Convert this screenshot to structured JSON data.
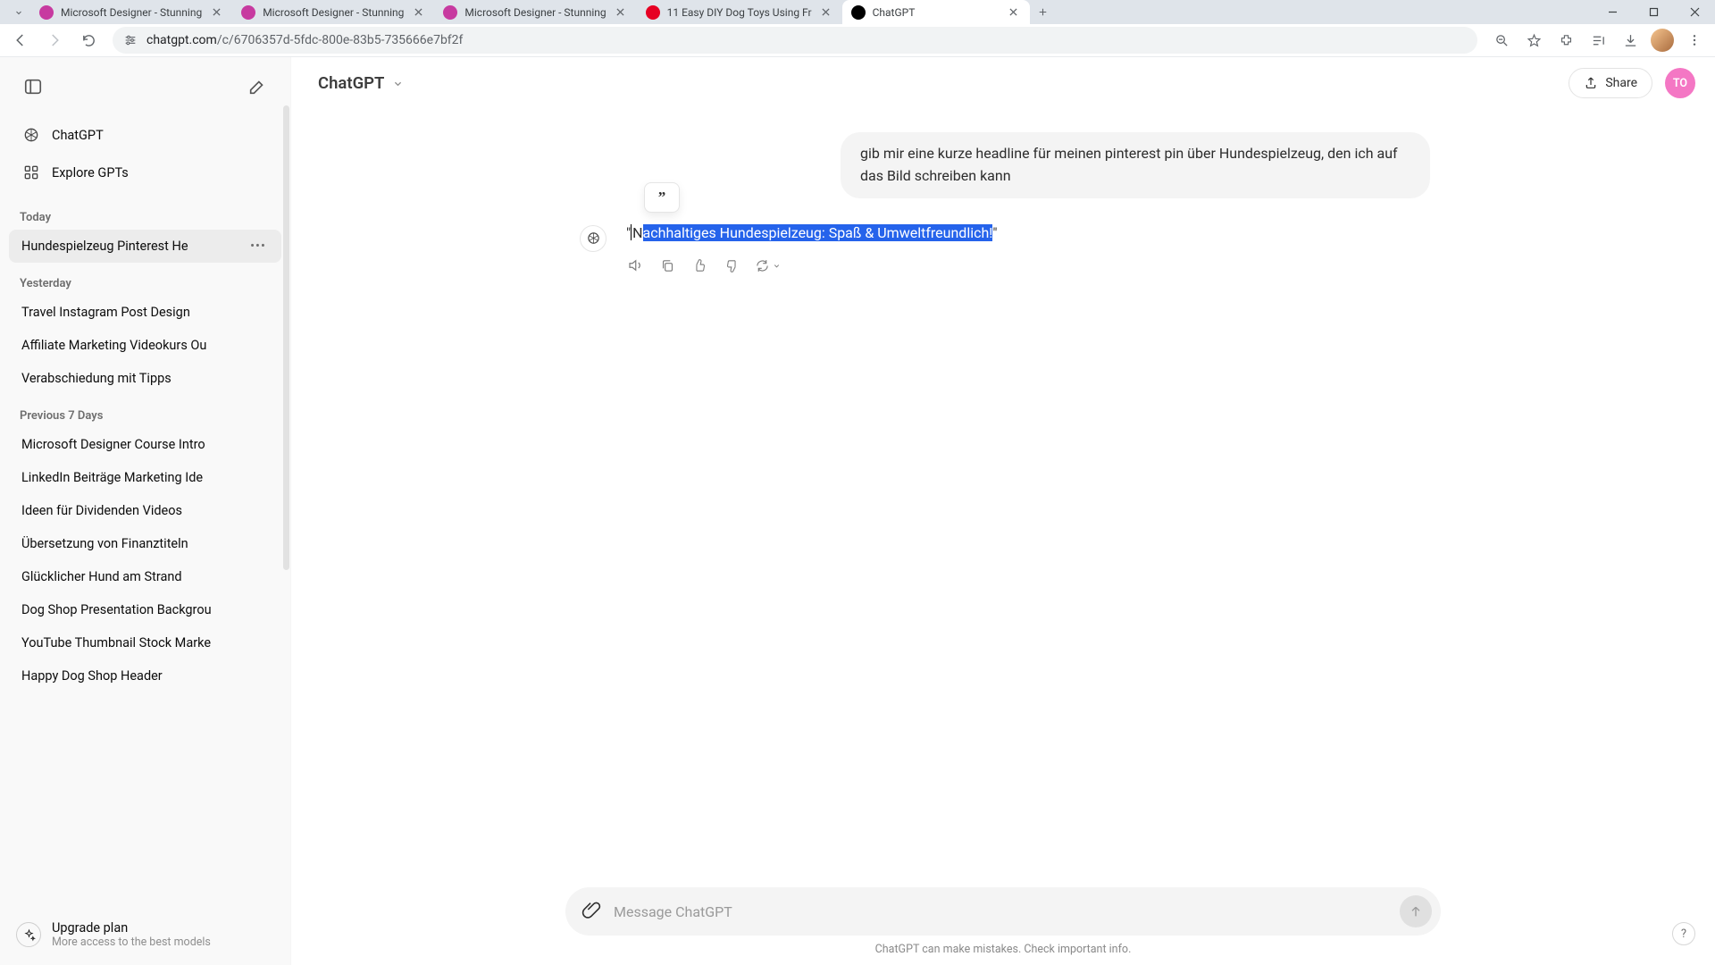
{
  "browser": {
    "tabs": [
      {
        "title": "Microsoft Designer - Stunning",
        "favicon": "#c73aa0"
      },
      {
        "title": "Microsoft Designer - Stunning",
        "favicon": "#c73aa0"
      },
      {
        "title": "Microsoft Designer - Stunning",
        "favicon": "#c73aa0"
      },
      {
        "title": "11 Easy DIY Dog Toys Using Fr",
        "favicon": "#e60023"
      },
      {
        "title": "ChatGPT",
        "favicon": "#000000",
        "active": true
      }
    ],
    "url_host": "chatgpt.com",
    "url_path": "/c/6706357d-5fdc-800e-83b5-735666e7bf2f"
  },
  "sidebar": {
    "nav_chatgpt": "ChatGPT",
    "nav_explore": "Explore GPTs",
    "sections": [
      {
        "header": "Today",
        "items": [
          "Hundespielzeug Pinterest He"
        ],
        "active_index": 0
      },
      {
        "header": "Yesterday",
        "items": [
          "Travel Instagram Post Design",
          "Affiliate Marketing Videokurs Ou",
          "Verabschiedung mit Tipps"
        ]
      },
      {
        "header": "Previous 7 Days",
        "items": [
          "Microsoft Designer Course Intro",
          "LinkedIn Beiträge Marketing Ide",
          "Ideen für Dividenden Videos",
          "Übersetzung von Finanztiteln",
          "Glücklicher Hund am Strand",
          "Dog Shop Presentation Backgrou",
          "YouTube Thumbnail Stock Marke",
          "Happy Dog Shop Header"
        ]
      }
    ],
    "plan_title": "Upgrade plan",
    "plan_sub": "More access to the best models"
  },
  "header": {
    "model": "ChatGPT",
    "share": "Share",
    "avatar_initials": "TO"
  },
  "conversation": {
    "user_message": "gib mir eine kurze headline für meinen pinterest pin über Hundespielzeug, den ich auf das Bild schreiben kann",
    "assistant_quote_open": "\"",
    "assistant_prefix_unselected": "N",
    "assistant_selected": "achhaltiges Hundespielzeug: Spaß & Umweltfreundlich!",
    "assistant_quote_close": "\""
  },
  "composer": {
    "placeholder": "Message ChatGPT",
    "disclaimer": "ChatGPT can make mistakes. Check important info."
  },
  "help_label": "?"
}
